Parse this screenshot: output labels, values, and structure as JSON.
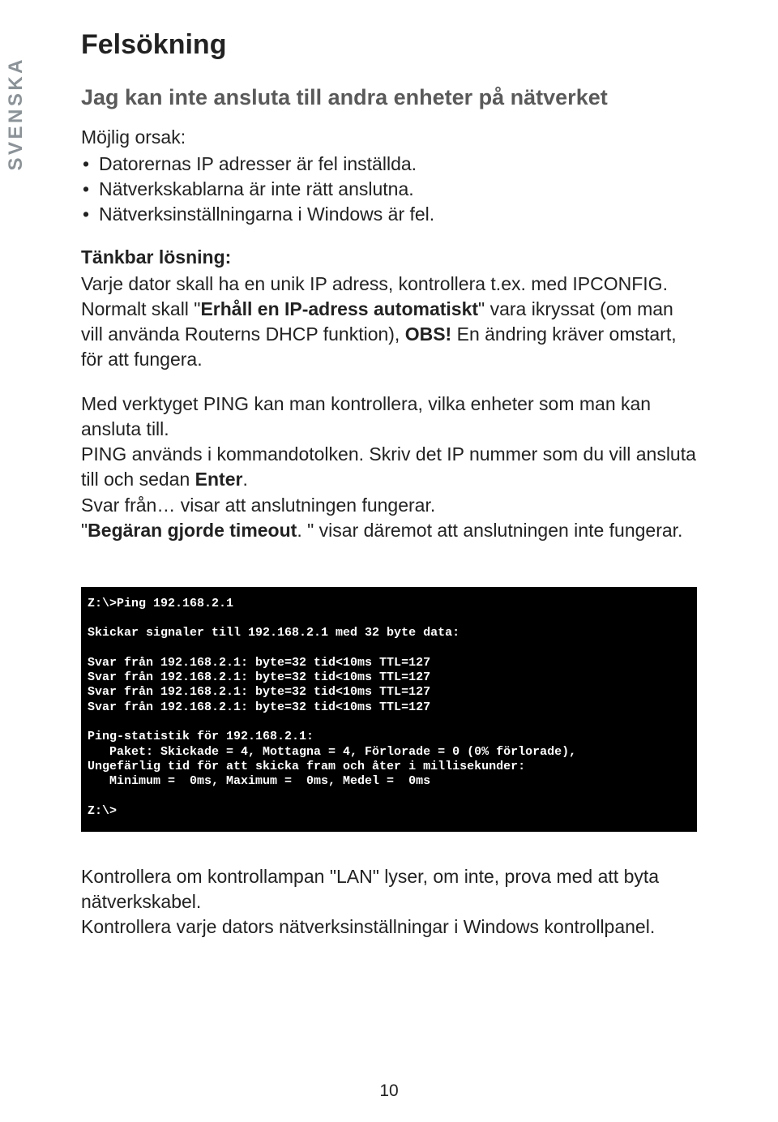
{
  "side_label": "SVENSKA",
  "heading": "Felsökning",
  "subheading": "Jag kan inte ansluta till andra enheter på nätverket",
  "cause_label": "Möjlig orsak:",
  "causes": [
    "Datorernas IP adresser är fel inställda.",
    "Nätverkskablarna är inte rätt anslutna.",
    "Nätverksinställningarna i Windows är fel."
  ],
  "solution_label": "Tänkbar lösning:",
  "solution": {
    "pre1": "Varje dator skall ha en unik IP adress, kontrollera t.ex. med IPCONFIG. Normalt skall \"",
    "bold1": "Erhåll en IP-adress automatiskt",
    "mid1": "\" vara ikryssat (om man vill använda Routerns DHCP funktion), ",
    "bold2": "OBS!",
    "post1": " En ändring kräver omstart, för att fungera."
  },
  "ping": {
    "p1": "Med verktyget PING kan man kontrollera, vilka enheter som man kan ansluta till.",
    "p2a": "PING används i kommandotolken. Skriv det IP nummer som du vill ansluta till och sedan ",
    "p2bold": "Enter",
    "p2b": ".",
    "p3": "Svar från… visar att anslutningen fungerar.",
    "p4a": "\"",
    "p4bold": "Begäran gjorde timeout",
    "p4b": ". \" visar däremot att anslutningen inte fungerar."
  },
  "terminal": "Z:\\>Ping 192.168.2.1\n\nSkickar signaler till 192.168.2.1 med 32 byte data:\n\nSvar från 192.168.2.1: byte=32 tid<10ms TTL=127\nSvar från 192.168.2.1: byte=32 tid<10ms TTL=127\nSvar från 192.168.2.1: byte=32 tid<10ms TTL=127\nSvar från 192.168.2.1: byte=32 tid<10ms TTL=127\n\nPing-statistik för 192.168.2.1:\n   Paket: Skickade = 4, Mottagna = 4, Förlorade = 0 (0% förlorade),\nUngefärlig tid för att skicka fram och åter i millisekunder:\n   Minimum =  0ms, Maximum =  0ms, Medel =  0ms\n\nZ:\\>",
  "bottom": {
    "p1": "Kontrollera om kontrollampan \"LAN\" lyser, om inte, prova med att byta nätverkskabel.",
    "p2": "Kontrollera varje dators nätverksinställningar i Windows kontrollpanel."
  },
  "page_number": "10"
}
